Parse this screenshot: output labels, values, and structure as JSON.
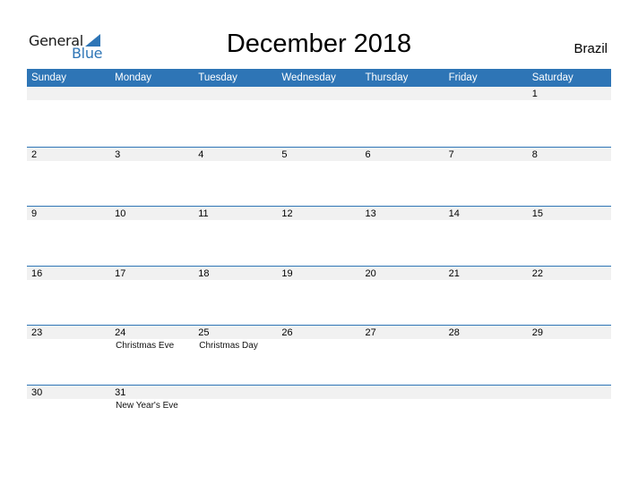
{
  "logo": {
    "line1": "General",
    "line2": "Blue"
  },
  "title": "December 2018",
  "country": "Brazil",
  "colors": {
    "accent": "#2e75b6",
    "strip": "#f1f1f1"
  },
  "weekdays": [
    "Sunday",
    "Monday",
    "Tuesday",
    "Wednesday",
    "Thursday",
    "Friday",
    "Saturday"
  ],
  "weeks": [
    [
      {
        "d": ""
      },
      {
        "d": ""
      },
      {
        "d": ""
      },
      {
        "d": ""
      },
      {
        "d": ""
      },
      {
        "d": ""
      },
      {
        "d": "1"
      }
    ],
    [
      {
        "d": "2"
      },
      {
        "d": "3"
      },
      {
        "d": "4"
      },
      {
        "d": "5"
      },
      {
        "d": "6"
      },
      {
        "d": "7"
      },
      {
        "d": "8"
      }
    ],
    [
      {
        "d": "9"
      },
      {
        "d": "10"
      },
      {
        "d": "11"
      },
      {
        "d": "12"
      },
      {
        "d": "13"
      },
      {
        "d": "14"
      },
      {
        "d": "15"
      }
    ],
    [
      {
        "d": "16"
      },
      {
        "d": "17"
      },
      {
        "d": "18"
      },
      {
        "d": "19"
      },
      {
        "d": "20"
      },
      {
        "d": "21"
      },
      {
        "d": "22"
      }
    ],
    [
      {
        "d": "23"
      },
      {
        "d": "24",
        "h": "Christmas Eve"
      },
      {
        "d": "25",
        "h": "Christmas Day"
      },
      {
        "d": "26"
      },
      {
        "d": "27"
      },
      {
        "d": "28"
      },
      {
        "d": "29"
      }
    ],
    [
      {
        "d": "30"
      },
      {
        "d": "31",
        "h": "New Year's Eve"
      },
      {
        "d": ""
      },
      {
        "d": ""
      },
      {
        "d": ""
      },
      {
        "d": ""
      },
      {
        "d": ""
      }
    ]
  ]
}
